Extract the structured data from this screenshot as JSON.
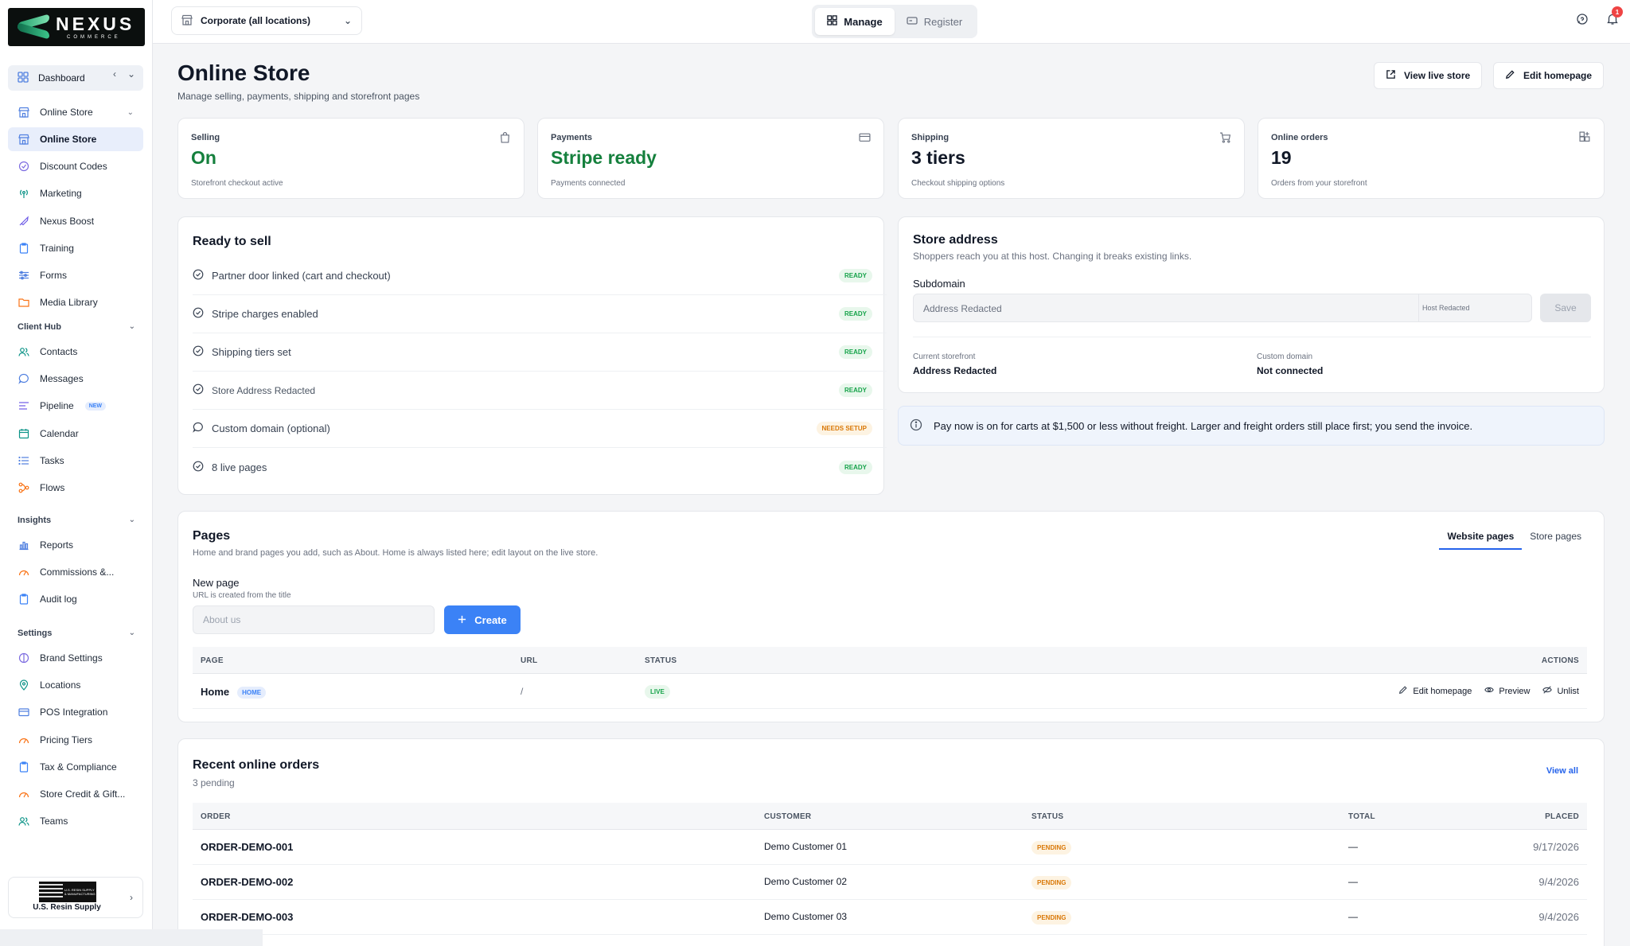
{
  "brand": {
    "name": "NEXUS",
    "tagline": "COMMERCE"
  },
  "sidebar": {
    "dashboard": "Dashboard",
    "main_items": [
      {
        "label": "Online Store",
        "icon": "store-icon",
        "expandable": true
      },
      {
        "label": "Online Store",
        "icon": "store-icon",
        "active": true
      },
      {
        "label": "Discount Codes",
        "icon": "discount-icon"
      },
      {
        "label": "Marketing",
        "icon": "broadcast-icon"
      },
      {
        "label": "Nexus Boost",
        "icon": "rocket-icon"
      },
      {
        "label": "Training",
        "icon": "clipboard-icon"
      },
      {
        "label": "Forms",
        "icon": "sliders-icon"
      },
      {
        "label": "Media Library",
        "icon": "folder-icon"
      }
    ],
    "sections": [
      {
        "title": "Client Hub",
        "items": [
          {
            "label": "Contacts",
            "icon": "users-icon"
          },
          {
            "label": "Messages",
            "icon": "chat-icon"
          },
          {
            "label": "Pipeline",
            "icon": "pipeline-icon",
            "badge": "NEW"
          },
          {
            "label": "Calendar",
            "icon": "calendar-icon"
          },
          {
            "label": "Tasks",
            "icon": "list-icon"
          },
          {
            "label": "Flows",
            "icon": "flows-icon"
          }
        ]
      },
      {
        "title": "Insights",
        "items": [
          {
            "label": "Reports",
            "icon": "bar-chart-icon"
          },
          {
            "label": "Commissions &...",
            "icon": "gauge-icon"
          },
          {
            "label": "Audit log",
            "icon": "clipboard-icon"
          }
        ]
      },
      {
        "title": "Settings",
        "items": [
          {
            "label": "Brand Settings",
            "icon": "palette-icon"
          },
          {
            "label": "Locations",
            "icon": "pin-icon"
          },
          {
            "label": "POS Integration",
            "icon": "card-icon"
          },
          {
            "label": "Pricing Tiers",
            "icon": "gauge-icon"
          },
          {
            "label": "Tax & Compliance",
            "icon": "clipboard-icon"
          },
          {
            "label": "Store Credit & Gift...",
            "icon": "gauge-icon"
          },
          {
            "label": "Teams",
            "icon": "users-icon"
          }
        ]
      }
    ],
    "org": {
      "name": "U.S. Resin Supply",
      "logo_text": "U.S. RESIN SUPPLY & MANUFACTURING"
    }
  },
  "topbar": {
    "location": "Corporate (all locations)",
    "modes": [
      "Manage",
      "Register"
    ],
    "active_mode": "Manage",
    "notifications": "1"
  },
  "header": {
    "title": "Online Store",
    "subtitle": "Manage selling, payments, shipping and storefront pages",
    "view_live": "View live store",
    "edit_home": "Edit homepage"
  },
  "stats": [
    {
      "label": "Selling",
      "value": "On",
      "sub": "Storefront checkout active",
      "green": true,
      "icon": "bag-icon"
    },
    {
      "label": "Payments",
      "value": "Stripe ready",
      "sub": "Payments connected",
      "green": true,
      "icon": "card-icon"
    },
    {
      "label": "Shipping",
      "value": "3 tiers",
      "sub": "Checkout shipping options",
      "green": false,
      "icon": "cart-icon"
    },
    {
      "label": "Online orders",
      "value": "19",
      "sub": "Orders from your storefront",
      "green": false,
      "icon": "grid-plus-icon"
    }
  ],
  "ready": {
    "title": "Ready to sell",
    "items": [
      {
        "label": "Partner door linked (cart and checkout)",
        "status": "READY",
        "icon": "check-circle-icon"
      },
      {
        "label": "Stripe charges enabled",
        "status": "READY",
        "icon": "check-circle-icon"
      },
      {
        "label": "Shipping tiers set",
        "status": "READY",
        "icon": "check-circle-icon"
      },
      {
        "label": "Store Address Redacted",
        "status": "READY",
        "icon": "check-circle-icon",
        "small": true
      },
      {
        "label": "Custom domain (optional)",
        "status": "NEEDS SETUP",
        "icon": "chat-icon"
      },
      {
        "label": "8 live pages",
        "status": "READY",
        "icon": "check-circle-icon"
      }
    ]
  },
  "address": {
    "title": "Store address",
    "subtitle": "Shoppers reach you at this host. Changing it breaks existing links.",
    "field_label": "Subdomain",
    "placeholder": "Address Redacted",
    "host": "Host Redacted",
    "save": "Save",
    "current_label": "Current storefront",
    "current_value": "Address Redacted",
    "domain_label": "Custom domain",
    "domain_value": "Not connected"
  },
  "info": "Pay now is on for carts at $1,500 or less without freight. Larger and freight orders still place first; you send the invoice.",
  "pages": {
    "title": "Pages",
    "subtitle": "Home and brand pages you add, such as About. Home is always listed here; edit layout on the live store.",
    "tabs": [
      "Website pages",
      "Store pages"
    ],
    "new_label": "New page",
    "new_hint": "URL is created from the title",
    "placeholder": "About us",
    "create": "Create",
    "columns": [
      "PAGE",
      "URL",
      "STATUS",
      "ACTIONS"
    ],
    "rows": [
      {
        "page": "Home",
        "badge": "HOME",
        "url": "/",
        "status": "LIVE",
        "actions": [
          "Edit homepage",
          "Preview",
          "Unlist"
        ]
      }
    ]
  },
  "orders": {
    "title": "Recent online orders",
    "subtitle": "3 pending",
    "view_all": "View all",
    "columns": [
      "ORDER",
      "CUSTOMER",
      "STATUS",
      "TOTAL",
      "PLACED"
    ],
    "rows": [
      {
        "order": "ORDER-DEMO-001",
        "customer": "Demo Customer 01",
        "status": "PENDING",
        "total": "—",
        "placed": "9/17/2026"
      },
      {
        "order": "ORDER-DEMO-002",
        "customer": "Demo Customer 02",
        "status": "PENDING",
        "total": "—",
        "placed": "9/4/2026"
      },
      {
        "order": "ORDER-DEMO-003",
        "customer": "Demo Customer 03",
        "status": "PENDING",
        "total": "—",
        "placed": "9/4/2026"
      }
    ]
  },
  "colors": {
    "accent": "#3b82f6",
    "success": "#15803d",
    "warning": "#d97706",
    "active_nav": "#e8eefb"
  }
}
